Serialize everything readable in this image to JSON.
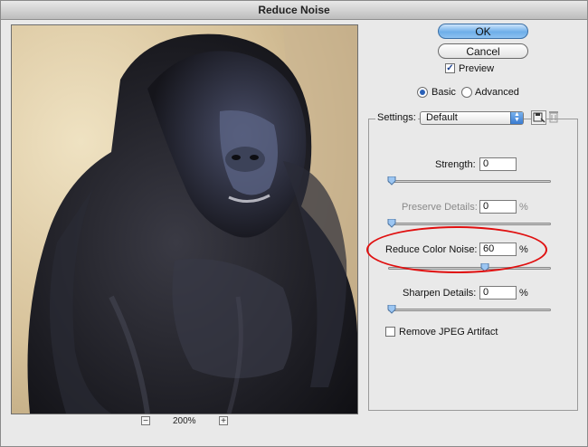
{
  "window": {
    "title": "Reduce Noise"
  },
  "buttons": {
    "ok": "OK",
    "cancel": "Cancel"
  },
  "preview_toggle": {
    "label": "Preview",
    "checked": true
  },
  "mode": {
    "basic": "Basic",
    "advanced": "Advanced",
    "selected": "basic"
  },
  "settings": {
    "label": "Settings:",
    "value": "Default"
  },
  "zoom": {
    "level": "200%",
    "minus": "−",
    "plus": "+"
  },
  "sliders": {
    "strength": {
      "label": "Strength:",
      "value": "0",
      "unit": "",
      "fraction": 0.0
    },
    "preserve": {
      "label": "Preserve Details:",
      "value": "0",
      "unit": "%",
      "fraction": 0.0,
      "disabled": true
    },
    "color_noise": {
      "label": "Reduce Color Noise:",
      "value": "60",
      "unit": "%",
      "fraction": 0.6
    },
    "sharpen": {
      "label": "Sharpen Details:",
      "value": "0",
      "unit": "%",
      "fraction": 0.0
    }
  },
  "jpeg": {
    "label": "Remove JPEG Artifact",
    "checked": false
  },
  "colors": {
    "accent": "#3a7bd0",
    "highlight": "#e01010"
  }
}
